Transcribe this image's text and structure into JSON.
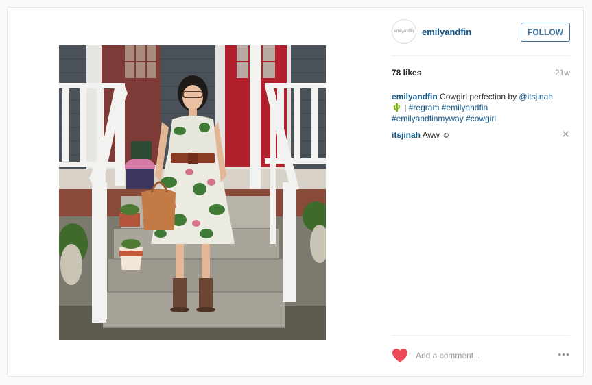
{
  "post": {
    "avatar_text": "emilyandfin",
    "username": "emilyandfin",
    "follow_label": "FOLLOW",
    "likes": "78 likes",
    "age": "21w",
    "comments": [
      {
        "user": "emilyandfin",
        "text_1": " Cowgirl perfection by ",
        "mention": "@itsjinah",
        "emoji": "🌵",
        "text_2": " | ",
        "hashtags": [
          "#regram",
          "#emilyandfin",
          "#emilyandfinmyway",
          "#cowgirl"
        ]
      },
      {
        "user": "itsjinah",
        "text": " Aww ☺"
      }
    ],
    "comment_placeholder": "Add a comment...",
    "more_label": "•••"
  },
  "colors": {
    "link": "#125688",
    "follow": "#3f729b",
    "heart": "#ed4956",
    "door": "#b21f2d"
  },
  "icons": {
    "heart": "heart-icon",
    "close": "close-icon",
    "more": "more-options-icon"
  }
}
